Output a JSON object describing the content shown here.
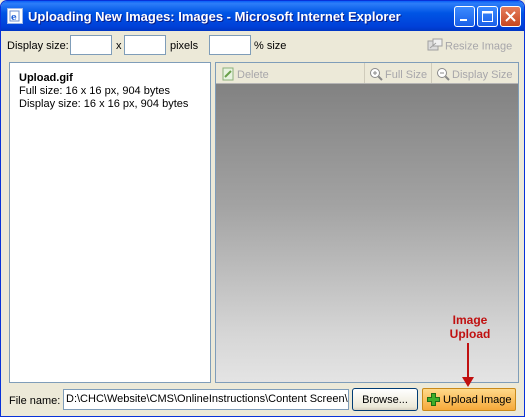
{
  "window": {
    "title": "Uploading New Images: Images - Microsoft Internet Explorer"
  },
  "toolbar": {
    "display_size_label": "Display size:",
    "width_value": "",
    "x_label": "x",
    "height_value": "",
    "pixels_label": "pixels",
    "percent_value": "",
    "percent_label": "% size",
    "resize_label": "Resize Image"
  },
  "file_info": {
    "name": "Upload.gif",
    "full_size": "Full size:  16 x 16 px, 904 bytes",
    "display_size": "Display size:  16 x 16 px, 904 bytes"
  },
  "preview_toolbar": {
    "delete_label": "Delete",
    "full_size_label": "Full Size",
    "display_size_label": "Display Size"
  },
  "annotation": {
    "line1": "Image",
    "line2": "Upload"
  },
  "bottom": {
    "file_name_label": "File name:",
    "path_value": "D:\\CHC\\Website\\CMS\\OnlineInstructions\\Content Screen\\p",
    "browse_label": "Browse...",
    "upload_label": "Upload Image"
  },
  "colors": {
    "titlebar": "#0055e5",
    "annotation": "#c01010",
    "upload_button": "#f6a93a"
  },
  "icons": [
    "ie-page-icon",
    "minimize-icon",
    "maximize-icon",
    "close-icon",
    "resize-icon",
    "delete-icon",
    "zoom-in-icon",
    "zoom-out-icon",
    "plus-icon",
    "arrow-down-icon"
  ]
}
